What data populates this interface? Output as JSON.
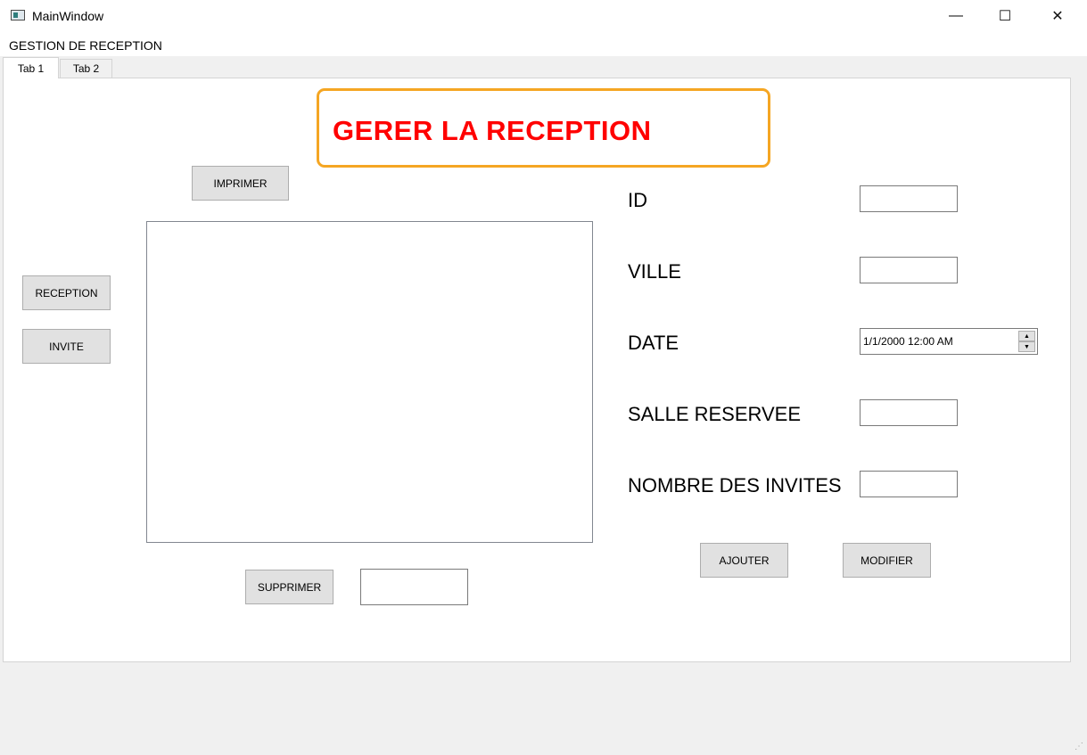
{
  "window": {
    "title": "MainWindow",
    "minimize_glyph": "—",
    "maximize_glyph": "☐",
    "close_glyph": "✕"
  },
  "menu": {
    "items": [
      "GESTION DE RECEPTION"
    ]
  },
  "tabs": [
    {
      "label": "Tab 1",
      "active": true
    },
    {
      "label": "Tab 2",
      "active": false
    }
  ],
  "header": {
    "title": "GERER LA RECEPTION"
  },
  "left_nav": {
    "reception_label": "RECEPTION",
    "invite_label": "INVITE"
  },
  "toolbar": {
    "print_label": "IMPRIMER",
    "delete_label": "SUPPRIMER",
    "delete_input_value": ""
  },
  "form": {
    "fields": [
      {
        "label": "ID",
        "value": ""
      },
      {
        "label": "VILLE",
        "value": ""
      },
      {
        "label": "DATE",
        "value": "1/1/2000 12:00 AM"
      },
      {
        "label": "SALLE RESERVEE",
        "value": ""
      },
      {
        "label": "NOMBRE DES INVITES",
        "value": ""
      }
    ],
    "add_label": "AJOUTER",
    "modify_label": "MODIFIER"
  },
  "colors": {
    "header_text": "#ff0000",
    "header_border": "#f5a623",
    "button_bg": "#e1e1e1"
  },
  "icons": {
    "spin_up": "▲",
    "spin_down": "▼",
    "resize_grip": "⋰"
  }
}
